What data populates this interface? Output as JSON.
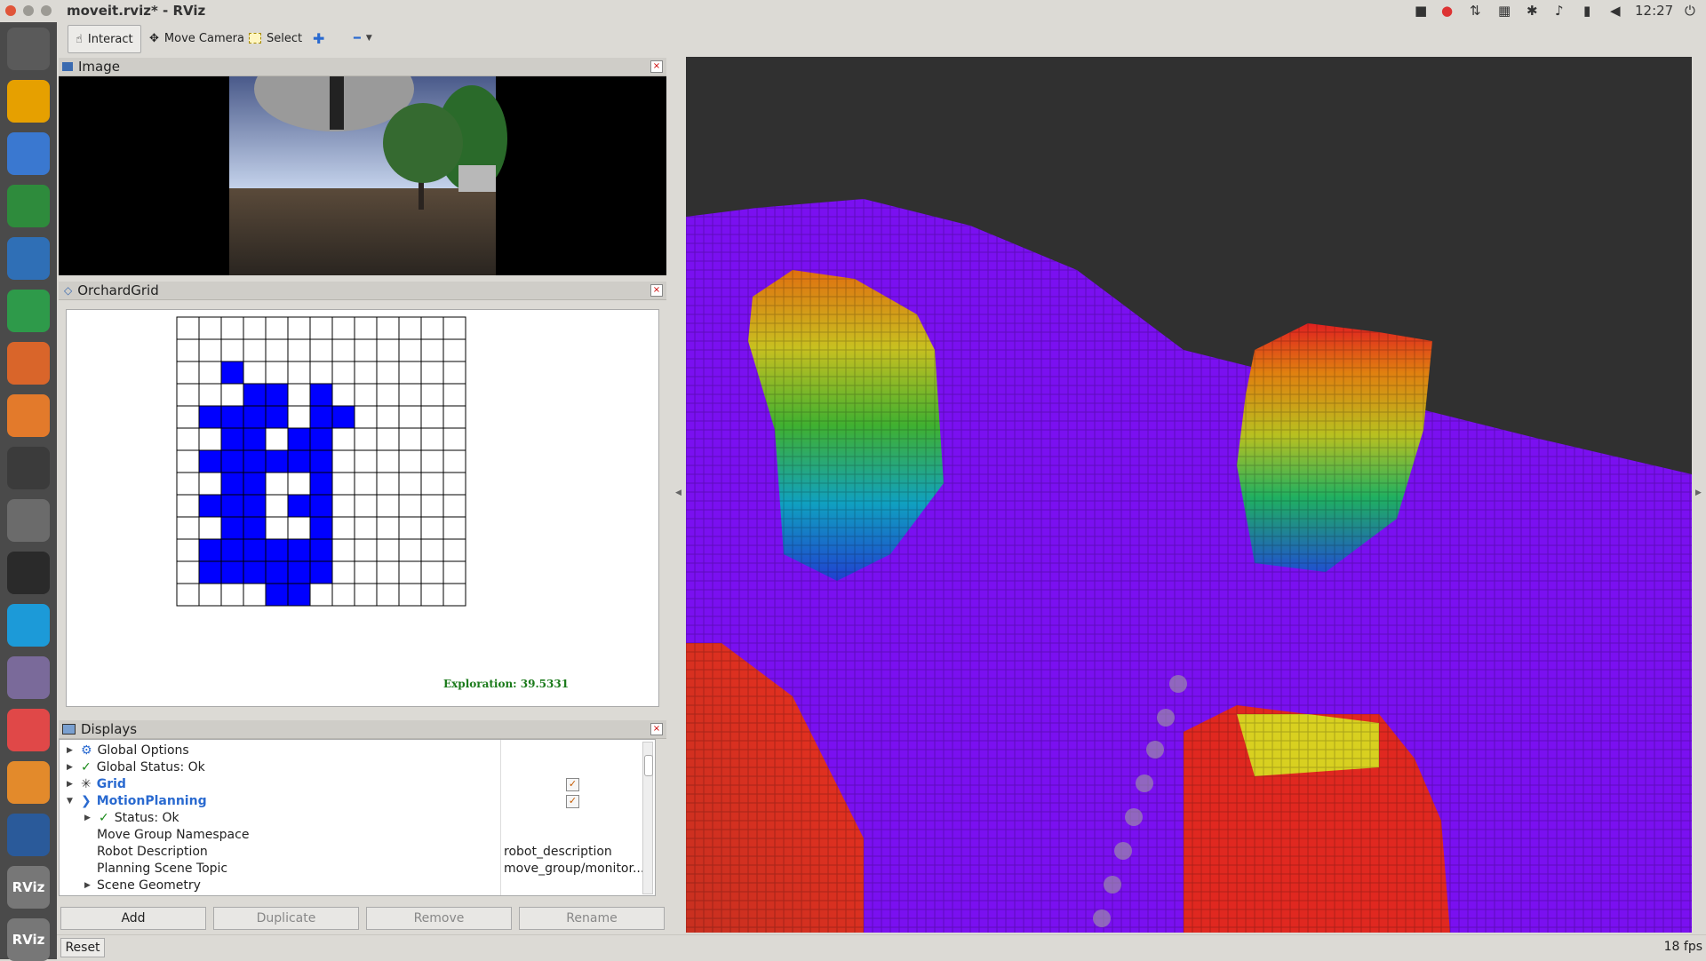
{
  "window": {
    "title": "moveit.rviz* - RViz"
  },
  "system_tray": {
    "time": "12:27"
  },
  "launcher": {
    "items": [
      {
        "name": "ubuntu-logo-icon",
        "color": "#5a5a5a"
      },
      {
        "name": "files-icon",
        "color": "#e6a000"
      },
      {
        "name": "chromium-icon",
        "color": "#3a78d0"
      },
      {
        "name": "chrome-icon",
        "color": "#2e8b3c"
      },
      {
        "name": "writer-icon",
        "color": "#2f6fb6"
      },
      {
        "name": "calc-icon",
        "color": "#2e9a4a"
      },
      {
        "name": "impress-icon",
        "color": "#d9652a"
      },
      {
        "name": "software-center-icon",
        "color": "#e37a2b"
      },
      {
        "name": "amazon-icon",
        "color": "#3b3b3b"
      },
      {
        "name": "settings-icon",
        "color": "#6b6b6b"
      },
      {
        "name": "terminal-icon",
        "color": "#2a2a2a"
      },
      {
        "name": "skype-icon",
        "color": "#1c9ad8"
      },
      {
        "name": "camera-icon",
        "color": "#7a6a9a"
      },
      {
        "name": "mail-icon",
        "color": "#e04848"
      },
      {
        "name": "sublime-icon",
        "color": "#e38a2b"
      },
      {
        "name": "vscode-icon",
        "color": "#2a5a9a"
      },
      {
        "name": "rviz-icon",
        "color": "#777777"
      },
      {
        "name": "rviz-icon-2",
        "color": "#777777"
      }
    ],
    "labels": {
      "rviz": "RViz",
      "rviz2": "RViz"
    }
  },
  "toolbar": {
    "interact": "Interact",
    "move_camera": "Move Camera",
    "select": "Select"
  },
  "image_panel": {
    "title": "Image"
  },
  "grid_panel": {
    "title": "OrchardGrid",
    "exploration": "Exploration: 39.5331",
    "rows": [
      [
        0,
        0,
        0,
        0,
        0,
        0,
        0,
        0,
        0,
        0,
        0,
        0,
        0
      ],
      [
        0,
        0,
        0,
        0,
        0,
        0,
        0,
        0,
        0,
        0,
        0,
        0,
        0
      ],
      [
        0,
        0,
        1,
        0,
        0,
        0,
        0,
        0,
        0,
        0,
        0,
        0,
        0
      ],
      [
        0,
        0,
        0,
        1,
        1,
        0,
        1,
        0,
        0,
        0,
        0,
        0,
        0
      ],
      [
        0,
        1,
        1,
        1,
        1,
        0,
        1,
        1,
        0,
        0,
        0,
        0,
        0
      ],
      [
        0,
        0,
        1,
        1,
        0,
        1,
        1,
        0,
        0,
        0,
        0,
        0,
        0
      ],
      [
        0,
        1,
        1,
        1,
        1,
        1,
        1,
        0,
        0,
        0,
        0,
        0,
        0
      ],
      [
        0,
        0,
        1,
        1,
        0,
        0,
        1,
        0,
        0,
        0,
        0,
        0,
        0
      ],
      [
        0,
        1,
        1,
        1,
        0,
        1,
        1,
        0,
        0,
        0,
        0,
        0,
        0
      ],
      [
        0,
        0,
        1,
        1,
        0,
        0,
        1,
        0,
        0,
        0,
        0,
        0,
        0
      ],
      [
        0,
        1,
        1,
        1,
        1,
        1,
        1,
        0,
        0,
        0,
        0,
        0,
        0
      ],
      [
        0,
        1,
        1,
        1,
        1,
        1,
        1,
        0,
        0,
        0,
        0,
        0,
        0
      ],
      [
        0,
        0,
        0,
        0,
        1,
        1,
        0,
        0,
        0,
        0,
        0,
        0,
        0
      ]
    ]
  },
  "displays_panel": {
    "title": "Displays",
    "rows": [
      {
        "label": "Global Options"
      },
      {
        "label": "Global Status: Ok"
      },
      {
        "label": "Grid"
      },
      {
        "label": "MotionPlanning"
      },
      {
        "label": "Status: Ok"
      },
      {
        "label": "Move Group Namespace"
      },
      {
        "label": "Robot Description",
        "value": "robot_description"
      },
      {
        "label": "Planning Scene Topic",
        "value": "move_group/monitor..."
      },
      {
        "label": "Scene Geometry"
      }
    ],
    "buttons": {
      "add": "Add",
      "duplicate": "Duplicate",
      "remove": "Remove",
      "rename": "Rename"
    }
  },
  "status_bar": {
    "reset": "Reset",
    "fps": "18 fps"
  }
}
